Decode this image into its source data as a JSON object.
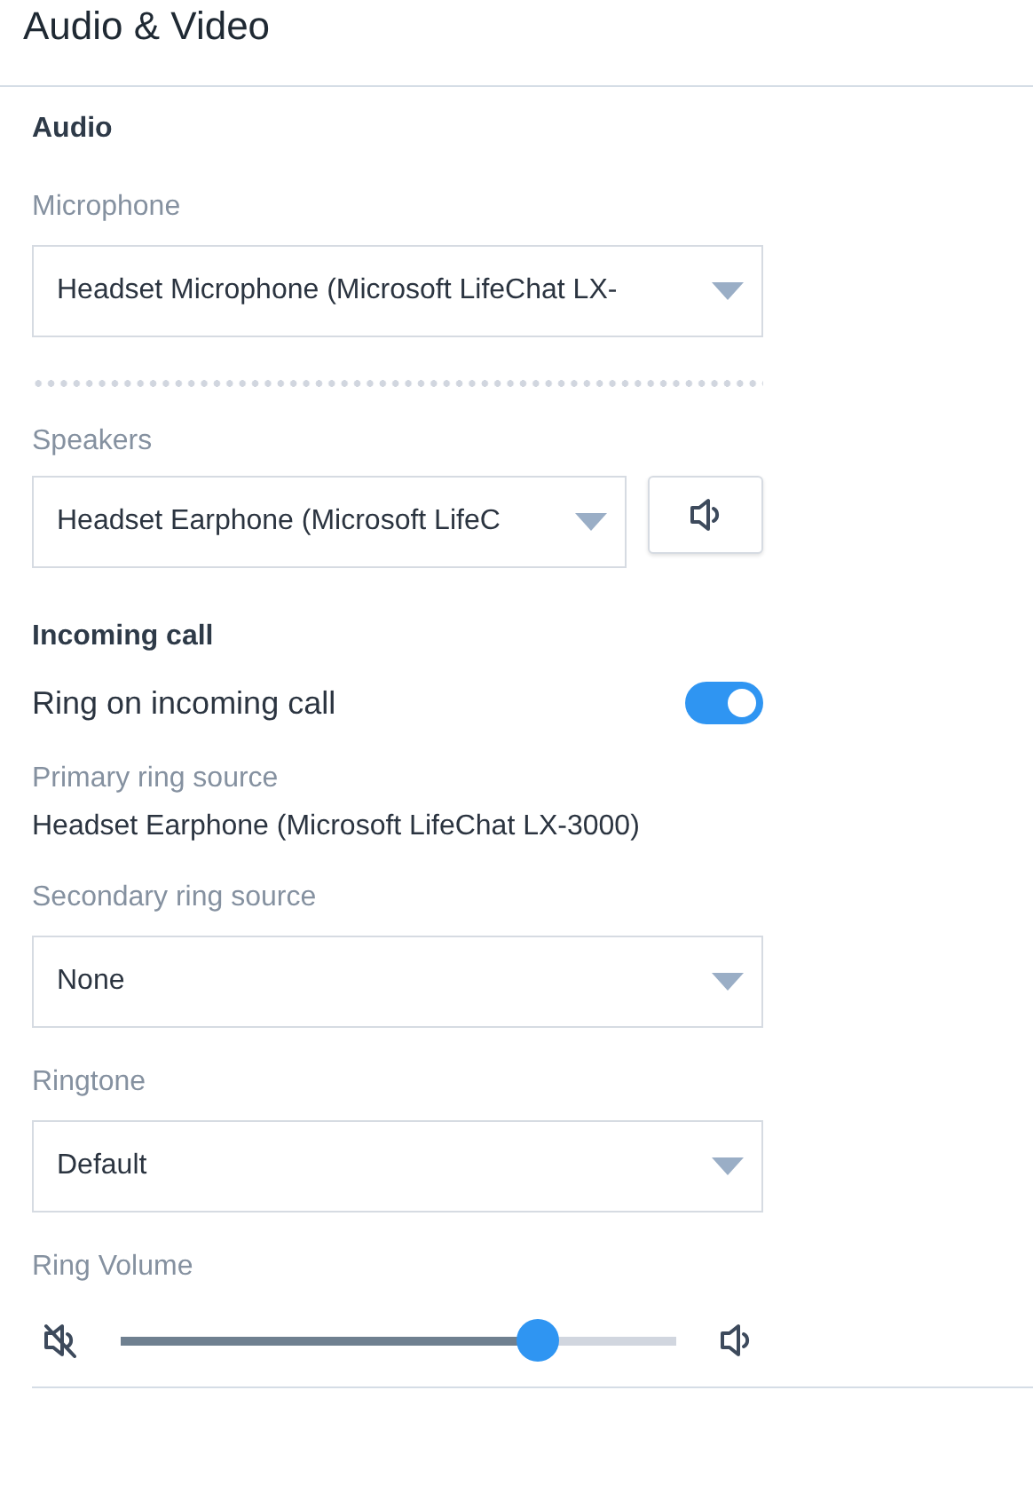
{
  "header": {
    "title": "Audio & Video"
  },
  "sections": [
    {
      "heading": "Audio",
      "items": [
        {
          "kind": "select",
          "label": "Microphone",
          "value": "Headset Microphone (Microsoft LifeChat LX-"
        },
        {
          "kind": "separator"
        },
        {
          "kind": "select_test",
          "label": "Speakers",
          "value": "Headset Earphone (Microsoft LifeC"
        }
      ]
    },
    {
      "heading": "Incoming call",
      "items": [
        {
          "kind": "toggle",
          "label": "Ring on incoming call",
          "on": true
        },
        {
          "kind": "info",
          "label": "Primary ring source",
          "value": "Headset Earphone (Microsoft LifeChat LX-3000)"
        },
        {
          "kind": "select",
          "label": "Secondary ring source",
          "value": "None"
        },
        {
          "kind": "select",
          "label": "Ringtone",
          "value": "Default"
        },
        {
          "kind": "slider",
          "label": "Ring Volume",
          "level": 0.75
        }
      ]
    }
  ]
}
